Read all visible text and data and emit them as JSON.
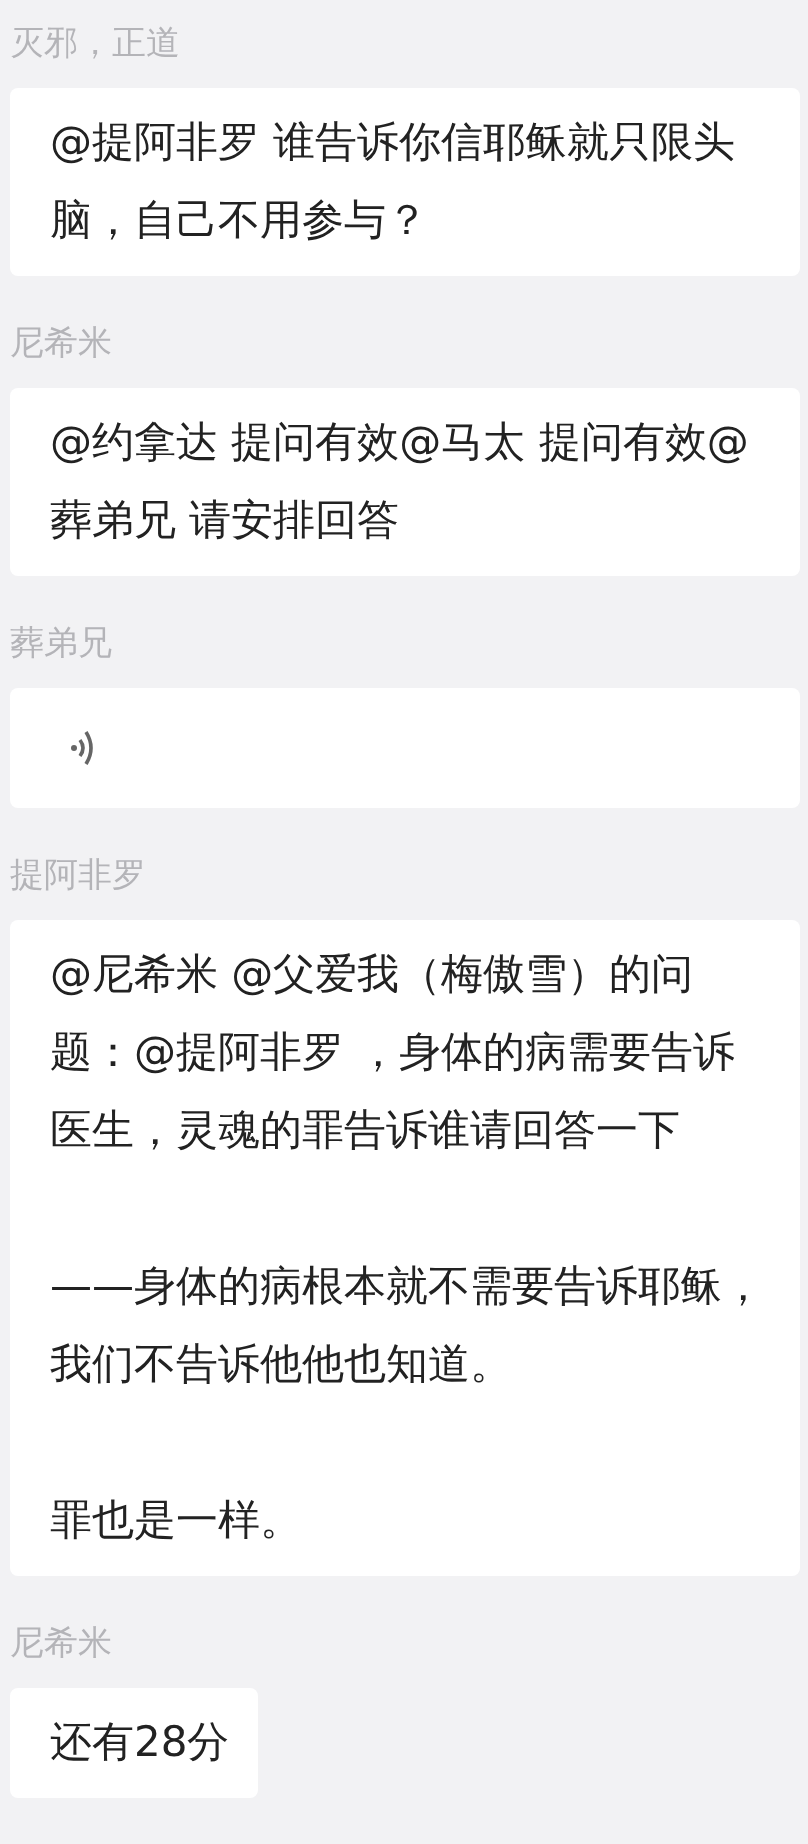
{
  "messages": [
    {
      "sender": "灭邪，正道",
      "kind": "text",
      "paragraphs": [
        "@提阿非罗 谁告诉你信耶稣就只限头脑，自己不用参与？"
      ]
    },
    {
      "sender": "尼希米",
      "kind": "text",
      "paragraphs": [
        "@约拿达 提问有效@马太 提问有效@葬弟兄 请安排回答"
      ]
    },
    {
      "sender": "葬弟兄",
      "kind": "voice"
    },
    {
      "sender": "提阿非罗",
      "kind": "text",
      "paragraphs": [
        "@尼希米 @父爱我（梅傲雪）的问题：@提阿非罗 ，身体的病需要告诉医生，灵魂的罪告诉谁请回答一下",
        "——身体的病根本就不需要告诉耶稣，我们不告诉他他也知道。",
        "罪也是一样。"
      ]
    },
    {
      "sender": "尼希米",
      "kind": "text",
      "paragraphs": [
        "还有28分"
      ]
    }
  ]
}
